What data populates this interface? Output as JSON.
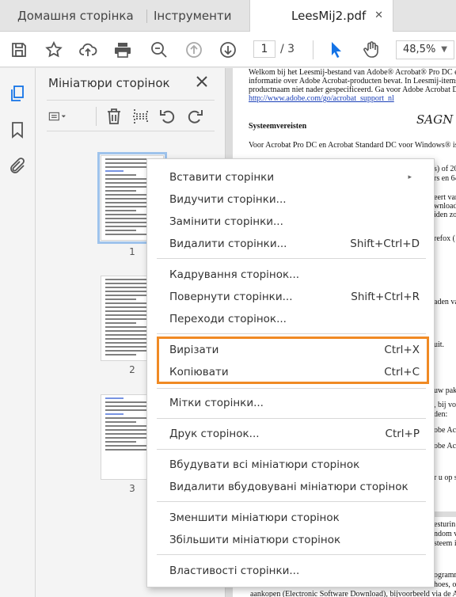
{
  "tabs": {
    "home": "Домашня сторінка",
    "tools": "Інструменти",
    "document": "LeesMij2.pdf",
    "close_glyph": "✕"
  },
  "toolbar": {
    "current_page": "1",
    "total_pages": "/ 3",
    "zoom": "48,5%",
    "zoom_caret": "▼"
  },
  "panel": {
    "title": "Мініатюри сторінок",
    "close_glyph": "✕",
    "pages": [
      {
        "number": "1"
      },
      {
        "number": "2"
      },
      {
        "number": "3"
      }
    ]
  },
  "document": {
    "lines": [
      "Welkom bij het Leesmij-bestand van Adobe® Acrobat® Pro DC en Adob",
      "informatie over Adobe Acrobat-producten bevat. In Leesmij-items",
      "productnaam niet nader gespecificeerd. Ga voor Adobe Acrobat DC-prod",
      "http://www.adobe.com/go/acrobat_support_nl",
      "Systeemvereisten",
      "Voor Acrobat Pro DC en Acrobat Standard DC voor Windows® is het vol",
      "s) of 20",
      "rs en 64",
      "eert van",
      "wnloadp",
      "iden zod",
      "refox (1",
      "aden va",
      "uit.",
      "uw pakl",
      ", bij voo",
      "den:",
      "obe Acro",
      "obe Acro",
      "r u op s",
      "esturin",
      "ndom v",
      "steem in",
      "ogramm",
      "hoes, of",
      "aankopen (Electronic Software Download), bijvoorbeeld via de Adobe St"
    ],
    "signature": "SAGN"
  },
  "context_menu": {
    "items": [
      {
        "label": "Вставити сторінки",
        "shortcut": "",
        "submenu": "▸"
      },
      {
        "label": "Видучити сторінки...",
        "shortcut": ""
      },
      {
        "label": "Замінити сторінки...",
        "shortcut": ""
      },
      {
        "label": "Видалити сторінки...",
        "shortcut": "Shift+Ctrl+D"
      },
      {
        "label": "Кадрування сторінок...",
        "shortcut": ""
      },
      {
        "label": "Повернути сторінки...",
        "shortcut": "Shift+Ctrl+R"
      },
      {
        "label": "Переходи сторінок...",
        "shortcut": ""
      },
      {
        "label": "Вирізати",
        "shortcut": "Ctrl+X"
      },
      {
        "label": "Копіювати",
        "shortcut": "Ctrl+C"
      },
      {
        "label": "Мітки сторінки...",
        "shortcut": ""
      },
      {
        "label": "Друк сторінок...",
        "shortcut": "Ctrl+P"
      },
      {
        "label": "Вбудувати всі мініатюри сторінок",
        "shortcut": ""
      },
      {
        "label": "Видалити вбудовувані мініатюри сторінок",
        "shortcut": ""
      },
      {
        "label": "Зменшити мініатюри сторінок",
        "shortcut": ""
      },
      {
        "label": "Збільшити мініатюри сторінок",
        "shortcut": ""
      },
      {
        "label": "Властивості сторінки...",
        "shortcut": ""
      }
    ]
  },
  "colors": {
    "highlight_box": "#f08a24",
    "accent_blue": "#1473e6",
    "selected_thumb": "#9ec3ec"
  },
  "icons": [
    "save-icon",
    "star-icon",
    "upload-icon",
    "print-icon",
    "zoom-out-icon",
    "page-up-icon",
    "page-down-icon",
    "pointer-icon",
    "hand-icon",
    "thumbnails-icon",
    "bookmark-icon",
    "attachment-icon",
    "options-icon",
    "trash-icon",
    "insert-page-icon",
    "rotate-left-icon",
    "rotate-right-icon"
  ]
}
